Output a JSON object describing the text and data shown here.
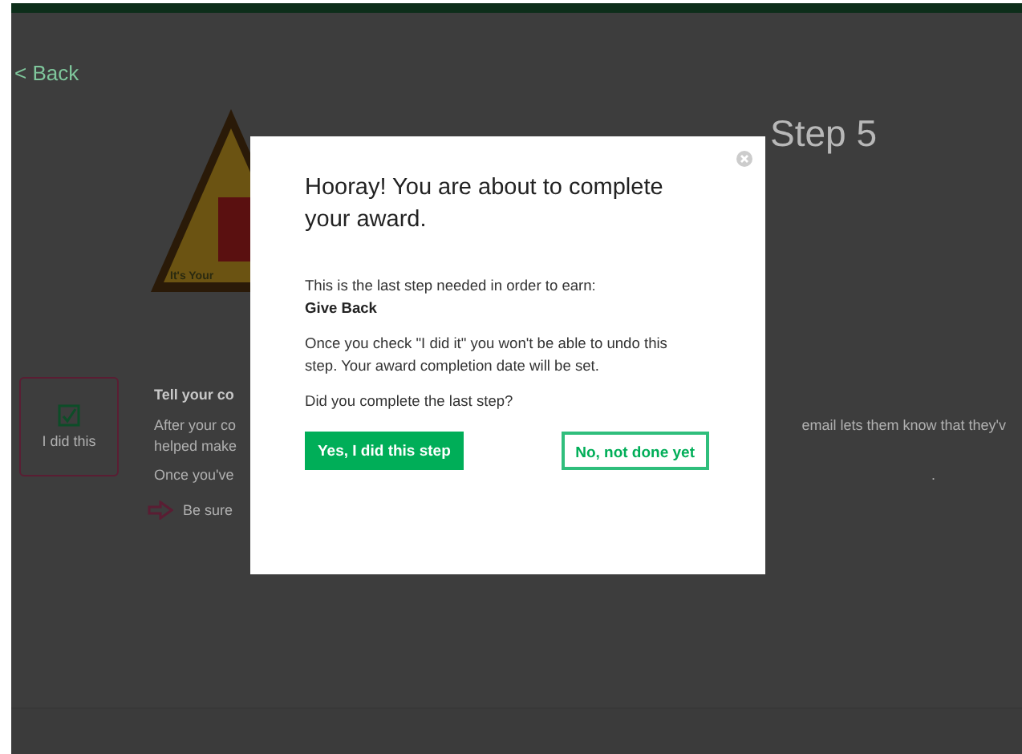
{
  "back_link": "< Back",
  "badge": {
    "caption": "It's Your"
  },
  "step_title": "Step 5",
  "step_check": {
    "label": "I did this",
    "checked": true
  },
  "step_text": {
    "heading": "Tell your co",
    "para_start": "After your co",
    "para_end": "email lets them know that they'v",
    "para_line2": "helped make",
    "note_start": "Once you've",
    "note_end": ".",
    "tip": "Be sure"
  },
  "modal": {
    "title": "Hooray! You are about to complete your award.",
    "intro": "This is the last step needed in order to earn:",
    "award_name": "Give Back",
    "warning": "Once you check \"I did it\" you won't be able to undo this step. Your award completion date will be set.",
    "question": "Did you complete the last step?",
    "buttons": [
      {
        "label": "Yes, I did this step",
        "kind": "primary"
      },
      {
        "label": "No, not done yet",
        "kind": "secondary"
      }
    ]
  }
}
